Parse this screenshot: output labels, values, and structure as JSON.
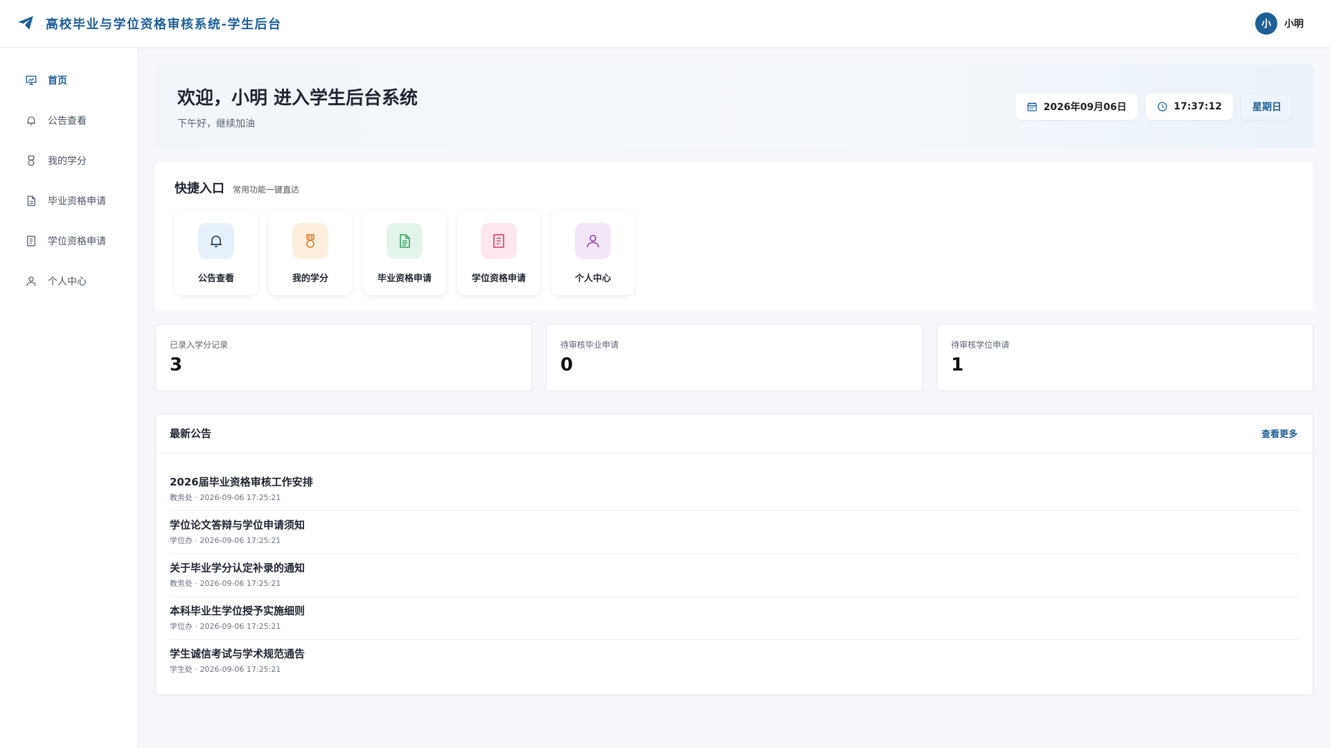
{
  "app": {
    "title": "高校毕业与学位资格审核系统-学生后台"
  },
  "user": {
    "avatar_text": "小",
    "name": "小明"
  },
  "sidebar": {
    "items": [
      {
        "label": "首页",
        "icon": "presentation-icon",
        "active": true
      },
      {
        "label": "公告查看",
        "icon": "bell-icon"
      },
      {
        "label": "我的学分",
        "icon": "medal-icon"
      },
      {
        "label": "毕业资格申请",
        "icon": "document-icon"
      },
      {
        "label": "学位资格申请",
        "icon": "form-icon"
      },
      {
        "label": "个人中心",
        "icon": "user-icon"
      }
    ]
  },
  "welcome": {
    "title": "欢迎，小明 进入学生后台系统",
    "subtitle": "下午好，继续加油",
    "date": "2026年09月06日",
    "time": "17:37:12",
    "weekday": "星期日"
  },
  "quick": {
    "title": "快捷入口",
    "subtitle": "常用功能一键直达",
    "items": [
      {
        "label": "公告查看",
        "icon": "bell-icon",
        "bg": "#e6f0fb",
        "fg": "#1f3b5a"
      },
      {
        "label": "我的学分",
        "icon": "medal-icon",
        "bg": "#fdeede",
        "fg": "#e07a1f"
      },
      {
        "label": "毕业资格申请",
        "icon": "document-icon",
        "bg": "#e3f5ea",
        "fg": "#2ea35c"
      },
      {
        "label": "学位资格申请",
        "icon": "form-icon",
        "bg": "#fde6ec",
        "fg": "#e03a6a"
      },
      {
        "label": "个人中心",
        "icon": "user-icon",
        "bg": "#f3e6f6",
        "fg": "#8e3aa8"
      }
    ]
  },
  "stats": [
    {
      "label": "已录入学分记录",
      "value": "3"
    },
    {
      "label": "待审核毕业申请",
      "value": "0"
    },
    {
      "label": "待审核学位申请",
      "value": "1"
    }
  ],
  "notices": {
    "title": "最新公告",
    "more": "查看更多",
    "items": [
      {
        "title": "2026届毕业资格审核工作安排",
        "meta": "教务处 · 2026-09-06 17:25:21"
      },
      {
        "title": "学位论文答辩与学位申请须知",
        "meta": "学位办 · 2026-09-06 17:25:21"
      },
      {
        "title": "关于毕业学分认定补录的通知",
        "meta": "教务处 · 2026-09-06 17:25:21"
      },
      {
        "title": "本科毕业生学位授予实施细则",
        "meta": "学位办 · 2026-09-06 17:25:21"
      },
      {
        "title": "学生诚信考试与学术规范通告",
        "meta": "学生处 · 2026-09-06 17:25:21"
      }
    ]
  },
  "colors": {
    "primary": "#1d5f96",
    "background": "#f5f7fa"
  }
}
